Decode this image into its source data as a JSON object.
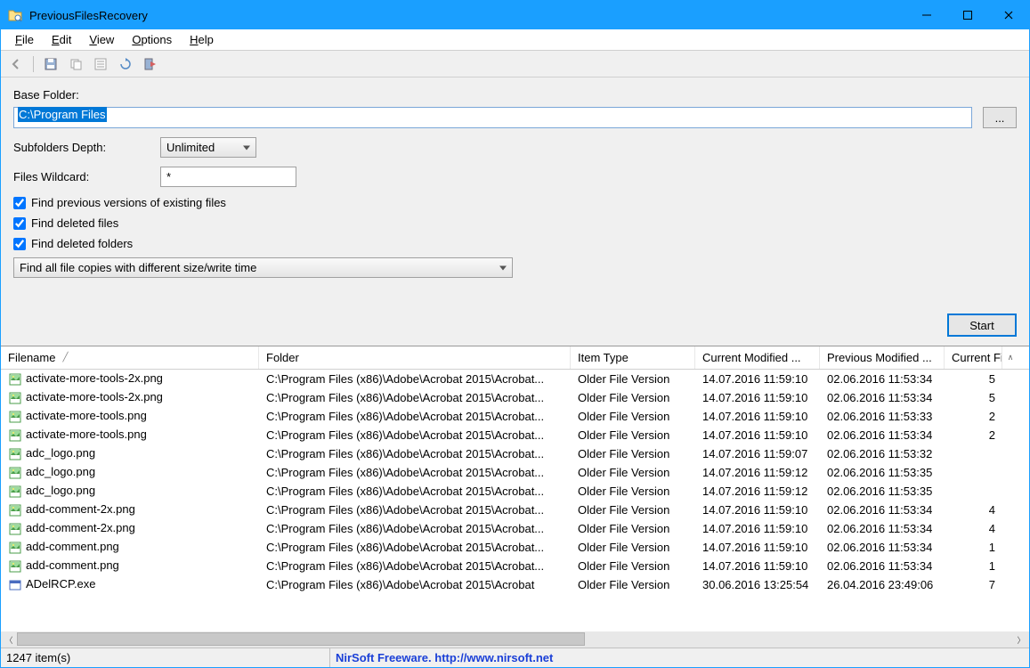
{
  "window": {
    "title": "PreviousFilesRecovery"
  },
  "menu": {
    "file": "File",
    "edit": "Edit",
    "view": "View",
    "options": "Options",
    "help": "Help"
  },
  "form": {
    "base_folder_label": "Base Folder:",
    "base_folder_value": "C:\\Program Files",
    "browse_label": "...",
    "subfolders_label": "Subfolders Depth:",
    "subfolders_value": "Unlimited",
    "wildcard_label": "Files Wildcard:",
    "wildcard_value": "*",
    "cb_versions": "Find previous versions of existing files",
    "cb_deleted_files": "Find deleted files",
    "cb_deleted_folders": "Find deleted folders",
    "filter_mode": "Find all file copies with different size/write time",
    "start_label": "Start"
  },
  "columns": {
    "filename": "Filename",
    "folder": "Folder",
    "item_type": "Item Type",
    "current_modified": "Current Modified ...",
    "previous_modified": "Previous Modified ...",
    "current_file": "Current Fil"
  },
  "rows": [
    {
      "icon": "png",
      "filename": "activate-more-tools-2x.png",
      "folder": "C:\\Program Files (x86)\\Adobe\\Acrobat 2015\\Acrobat...",
      "type": "Older File Version",
      "cm": "14.07.2016 11:59:10",
      "pm": "02.06.2016 11:53:34",
      "cf": "5"
    },
    {
      "icon": "png",
      "filename": "activate-more-tools-2x.png",
      "folder": "C:\\Program Files (x86)\\Adobe\\Acrobat 2015\\Acrobat...",
      "type": "Older File Version",
      "cm": "14.07.2016 11:59:10",
      "pm": "02.06.2016 11:53:34",
      "cf": "5"
    },
    {
      "icon": "png",
      "filename": "activate-more-tools.png",
      "folder": "C:\\Program Files (x86)\\Adobe\\Acrobat 2015\\Acrobat...",
      "type": "Older File Version",
      "cm": "14.07.2016 11:59:10",
      "pm": "02.06.2016 11:53:33",
      "cf": "2"
    },
    {
      "icon": "png",
      "filename": "activate-more-tools.png",
      "folder": "C:\\Program Files (x86)\\Adobe\\Acrobat 2015\\Acrobat...",
      "type": "Older File Version",
      "cm": "14.07.2016 11:59:10",
      "pm": "02.06.2016 11:53:34",
      "cf": "2"
    },
    {
      "icon": "png",
      "filename": "adc_logo.png",
      "folder": "C:\\Program Files (x86)\\Adobe\\Acrobat 2015\\Acrobat...",
      "type": "Older File Version",
      "cm": "14.07.2016 11:59:07",
      "pm": "02.06.2016 11:53:32",
      "cf": ""
    },
    {
      "icon": "png",
      "filename": "adc_logo.png",
      "folder": "C:\\Program Files (x86)\\Adobe\\Acrobat 2015\\Acrobat...",
      "type": "Older File Version",
      "cm": "14.07.2016 11:59:12",
      "pm": "02.06.2016 11:53:35",
      "cf": ""
    },
    {
      "icon": "png",
      "filename": "adc_logo.png",
      "folder": "C:\\Program Files (x86)\\Adobe\\Acrobat 2015\\Acrobat...",
      "type": "Older File Version",
      "cm": "14.07.2016 11:59:12",
      "pm": "02.06.2016 11:53:35",
      "cf": ""
    },
    {
      "icon": "png",
      "filename": "add-comment-2x.png",
      "folder": "C:\\Program Files (x86)\\Adobe\\Acrobat 2015\\Acrobat...",
      "type": "Older File Version",
      "cm": "14.07.2016 11:59:10",
      "pm": "02.06.2016 11:53:34",
      "cf": "4"
    },
    {
      "icon": "png",
      "filename": "add-comment-2x.png",
      "folder": "C:\\Program Files (x86)\\Adobe\\Acrobat 2015\\Acrobat...",
      "type": "Older File Version",
      "cm": "14.07.2016 11:59:10",
      "pm": "02.06.2016 11:53:34",
      "cf": "4"
    },
    {
      "icon": "png",
      "filename": "add-comment.png",
      "folder": "C:\\Program Files (x86)\\Adobe\\Acrobat 2015\\Acrobat...",
      "type": "Older File Version",
      "cm": "14.07.2016 11:59:10",
      "pm": "02.06.2016 11:53:34",
      "cf": "1"
    },
    {
      "icon": "png",
      "filename": "add-comment.png",
      "folder": "C:\\Program Files (x86)\\Adobe\\Acrobat 2015\\Acrobat...",
      "type": "Older File Version",
      "cm": "14.07.2016 11:59:10",
      "pm": "02.06.2016 11:53:34",
      "cf": "1"
    },
    {
      "icon": "exe",
      "filename": "ADelRCP.exe",
      "folder": "C:\\Program Files (x86)\\Adobe\\Acrobat 2015\\Acrobat",
      "type": "Older File Version",
      "cm": "30.06.2016 13:25:54",
      "pm": "26.04.2016 23:49:06",
      "cf": "7"
    }
  ],
  "status": {
    "count": "1247 item(s)",
    "right": "NirSoft Freeware.  http://www.nirsoft.net"
  }
}
